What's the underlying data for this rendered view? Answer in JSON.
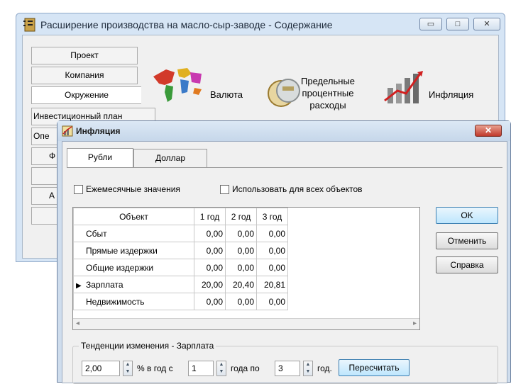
{
  "main_window": {
    "title": "Расширение производства на масло-сыр-заводе - Содержание",
    "controls": {
      "minimize": "▭",
      "maximize": "□",
      "close": "✕"
    },
    "nav": [
      "Проект",
      "Компания",
      "Окружение",
      "Инвестиционный план",
      "Опе",
      "Ф",
      "",
      "А",
      ""
    ],
    "categories": {
      "currency": "Валюта",
      "interest": [
        "Предельные",
        "процентные",
        "расходы"
      ],
      "inflation": "Инфляция"
    }
  },
  "dialog": {
    "title": "Инфляция",
    "close": "✕",
    "tabs": [
      "Рубли",
      "Доллар"
    ],
    "options": {
      "monthly": "Ежемесячные значения",
      "all_objects": "Использовать для всех объектов"
    },
    "table": {
      "headers": [
        "Объект",
        "1 год",
        "2 год",
        "3 год"
      ],
      "rows": [
        {
          "name": "Сбыт",
          "y1": "0,00",
          "y2": "0,00",
          "y3": "0,00",
          "marker": ""
        },
        {
          "name": "Прямые издержки",
          "y1": "0,00",
          "y2": "0,00",
          "y3": "0,00",
          "marker": ""
        },
        {
          "name": "Общие издержки",
          "y1": "0,00",
          "y2": "0,00",
          "y3": "0,00",
          "marker": ""
        },
        {
          "name": "Зарплата",
          "y1": "20,00",
          "y2": "20,40",
          "y3": "20,81",
          "marker": "▶"
        },
        {
          "name": "Недвижимость",
          "y1": "0,00",
          "y2": "0,00",
          "y3": "0,00",
          "marker": ""
        }
      ],
      "scroll_left": "◂",
      "scroll_right": "▸"
    },
    "buttons": {
      "ok": "OK",
      "cancel": "Отменить",
      "help": "Справка"
    },
    "trend": {
      "legend": "Тенденции изменения - Зарплата",
      "rate": "2,00",
      "rate_unit": "% в год с",
      "from_year": "1",
      "between": "года по",
      "to_year": "3",
      "year_unit": "год.",
      "recalc": "Пересчитать"
    }
  },
  "icons": {
    "app": "notebook-icon",
    "dialog": "inflation-small-icon"
  },
  "colors": {
    "accent": "#3c7fb1",
    "title_bar": "#d6e5f5",
    "close": "#c0392b"
  }
}
